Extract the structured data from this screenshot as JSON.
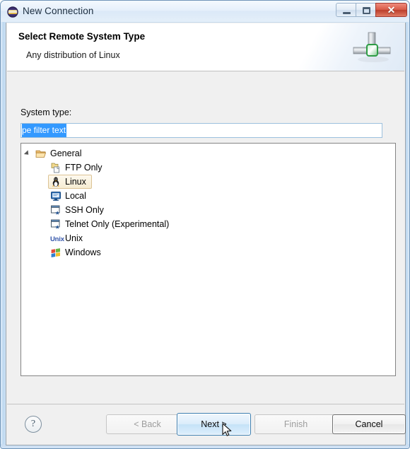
{
  "window": {
    "title": "New Connection",
    "icon": "eclipse-sphere-icon",
    "controls": {
      "minimize": "minimize-button",
      "maximize": "maximize-button",
      "close_glyph": "✕"
    }
  },
  "header": {
    "title": "Select Remote System Type",
    "subtitle": "Any distribution of Linux",
    "icon": "network-connection-icon",
    "accent_color": "#2e9c45"
  },
  "form": {
    "system_type_label": "System type:",
    "filter": {
      "value": "type filter text",
      "visible_value": "pe filter text",
      "placeholder": "type filter text",
      "selected": true,
      "selection_color": "#3399ff"
    }
  },
  "tree": {
    "root": {
      "label": "General",
      "icon": "open-folder-icon",
      "expanded": true
    },
    "items": [
      {
        "label": "FTP Only",
        "icon": "ftp-copy-icon",
        "selected": false
      },
      {
        "label": "Linux",
        "icon": "linux-penguin-icon",
        "selected": true
      },
      {
        "label": "Local",
        "icon": "monitor-icon",
        "selected": false
      },
      {
        "label": "SSH Only",
        "icon": "ssh-window-icon",
        "selected": false
      },
      {
        "label": "Telnet Only (Experimental)",
        "icon": "telnet-window-icon",
        "selected": false
      },
      {
        "label": "Unix",
        "icon": "unix-text-icon",
        "selected": false
      },
      {
        "label": "Windows",
        "icon": "windows-flag-icon",
        "selected": false
      }
    ]
  },
  "buttons": {
    "help": "?",
    "back": "< Back",
    "next": "Next >",
    "finish": "Finish",
    "cancel": "Cancel",
    "back_disabled": true,
    "finish_disabled": true,
    "next_focused": true
  }
}
